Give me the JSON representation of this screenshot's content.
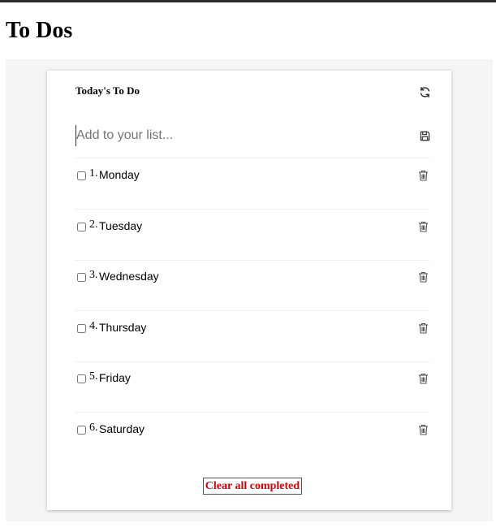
{
  "page": {
    "title": "To Dos"
  },
  "card": {
    "title": "Today's To Do",
    "refresh_icon": "refresh-icon",
    "add_placeholder": "Add to your list...",
    "add_value": "",
    "save_icon": "save-icon"
  },
  "items": [
    {
      "number": "1.",
      "label": "Monday",
      "completed": false
    },
    {
      "number": "2.",
      "label": "Tuesday",
      "completed": false
    },
    {
      "number": "3.",
      "label": "Wednesday",
      "completed": false
    },
    {
      "number": "4.",
      "label": "Thursday",
      "completed": false
    },
    {
      "number": "5.",
      "label": "Friday",
      "completed": false
    },
    {
      "number": "6.",
      "label": "Saturday",
      "completed": false
    }
  ],
  "footer": {
    "clear_label": "Clear all completed"
  },
  "colors": {
    "clear_text": "#e00000",
    "icon": "#555555",
    "panel_bg": "#f5f5f5"
  }
}
